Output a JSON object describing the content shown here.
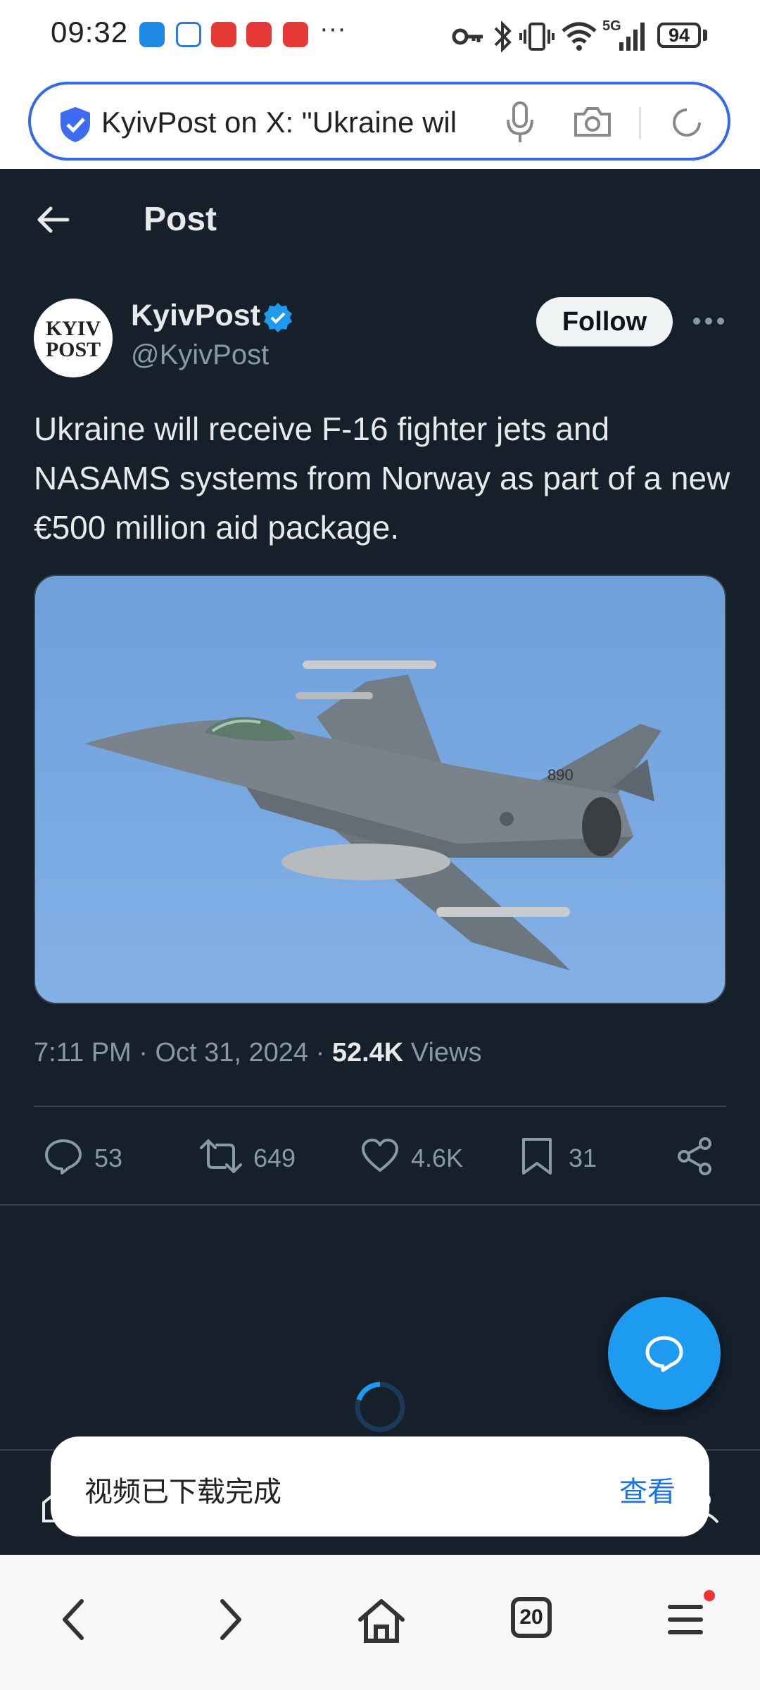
{
  "status_bar": {
    "time": "09:32",
    "more": "···",
    "network": "5G",
    "battery": "94"
  },
  "url_bar": {
    "text": "KyivPost on X: \"Ukraine wil",
    "accent": "#3469ea"
  },
  "header": {
    "title": "Post"
  },
  "post": {
    "avatar_line1": "KYIV",
    "avatar_line2": "POST",
    "author_name": "KyivPost",
    "handle": "@KyivPost",
    "follow_label": "Follow",
    "text": "Ukraine will receive F-16 fighter jets and NASAMS systems from Norway as part of a new €500 million aid package.",
    "time_date": "7:11 PM · Oct 31, 2024 · ",
    "views_count": "52.4K",
    "views_label": " Views",
    "jet_tail_number": "890"
  },
  "actions": {
    "replies": "53",
    "reposts": "649",
    "likes": "4.6K",
    "bookmarks": "31"
  },
  "toast": {
    "message": "视频已下载完成",
    "action": "查看"
  },
  "browser_nav": {
    "tab_count": "20"
  },
  "colors": {
    "background": "#15202b",
    "twitter_blue": "#1d9bf0",
    "text_primary": "#e7e9ea",
    "text_secondary": "#8b98a5"
  }
}
